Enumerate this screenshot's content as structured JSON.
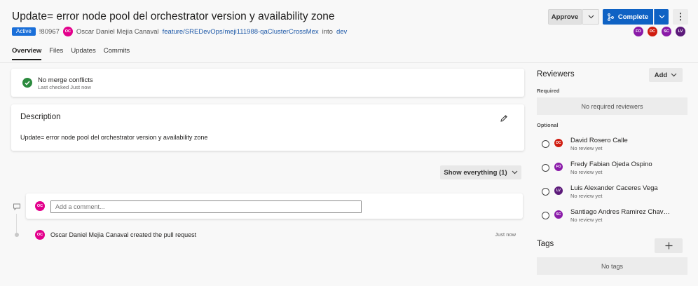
{
  "pr": {
    "title": "Update= error node pool del  orchestrator version y availability zone",
    "status": "Active",
    "id": "!80967",
    "author_initials": "OC",
    "author": "Oscar Daniel Mejia Canaval",
    "source_branch": "feature/SREDevOps/meji111988-qaClusterCrossMex",
    "into_text": "into",
    "target_branch": "dev"
  },
  "actions": {
    "approve_label": "Approve",
    "complete_label": "Complete"
  },
  "header_reviewers": [
    {
      "initials": "FO",
      "color": "#8a1aa8"
    },
    {
      "initials": "DC",
      "color": "#d01c10"
    },
    {
      "initials": "SC",
      "color": "#8a1aa8"
    },
    {
      "initials": "LV",
      "color": "#5c1a7a"
    }
  ],
  "tabs": [
    {
      "label": "Overview",
      "active": true
    },
    {
      "label": "Files",
      "active": false
    },
    {
      "label": "Updates",
      "active": false
    },
    {
      "label": "Commits",
      "active": false
    }
  ],
  "merge": {
    "title": "No merge conflicts",
    "subtitle": "Last checked Just now"
  },
  "description": {
    "heading": "Description",
    "text": "Update= error node pool del orchestrator version y availability zone"
  },
  "filter": {
    "label": "Show everything (1)"
  },
  "comment": {
    "avatar_initials": "OC",
    "placeholder": "Add a comment..."
  },
  "activity": {
    "avatar_initials": "OC",
    "text": "Oscar Daniel Mejia Canaval created the pull request",
    "time": "Just now"
  },
  "reviewers": {
    "heading": "Reviewers",
    "add_label": "Add",
    "required_label": "Required",
    "required_empty": "No required reviewers",
    "optional_label": "Optional",
    "optional": [
      {
        "initials": "DC",
        "name": "David Rosero Calle",
        "status": "No review yet",
        "color": "#d01c10"
      },
      {
        "initials": "FO",
        "name": "Fredy Fabian Ojeda Ospino",
        "status": "No review yet",
        "color": "#8a1aa8"
      },
      {
        "initials": "LV",
        "name": "Luis Alexander Caceres Vega",
        "status": "No review yet",
        "color": "#5c1a7a"
      },
      {
        "initials": "SC",
        "name": "Santiago Andres Ramirez Chav…",
        "status": "No review yet",
        "color": "#8a1aa8"
      }
    ]
  },
  "tags": {
    "heading": "Tags",
    "empty": "No tags"
  },
  "colors": {
    "primary": "#0f62c4",
    "author_avatar": "#e3008c",
    "success": "#2b8a3e"
  }
}
